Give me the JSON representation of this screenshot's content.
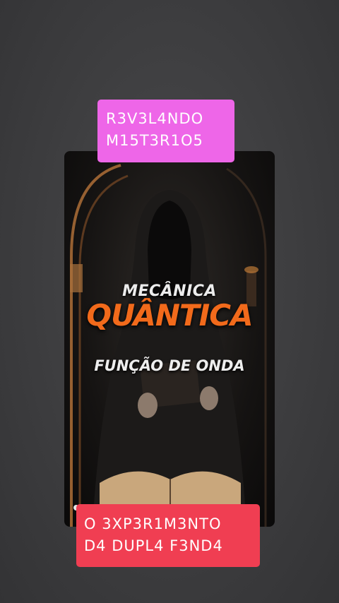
{
  "caption_top": {
    "line1": "R3V3L4NDO",
    "line2": "M15T3R1O5",
    "color": "#ee66e8"
  },
  "poster": {
    "line1": "MECÂNICA",
    "line2": "QUÂNTICA",
    "line3": "FUNÇÃO DE ONDA",
    "accent_color": "#f26a1b"
  },
  "caption_bottom": {
    "line1": "O 3XP3R1M3NTO",
    "line2": "D4 DUPL4 F3ND4",
    "color": "#f03e52"
  }
}
